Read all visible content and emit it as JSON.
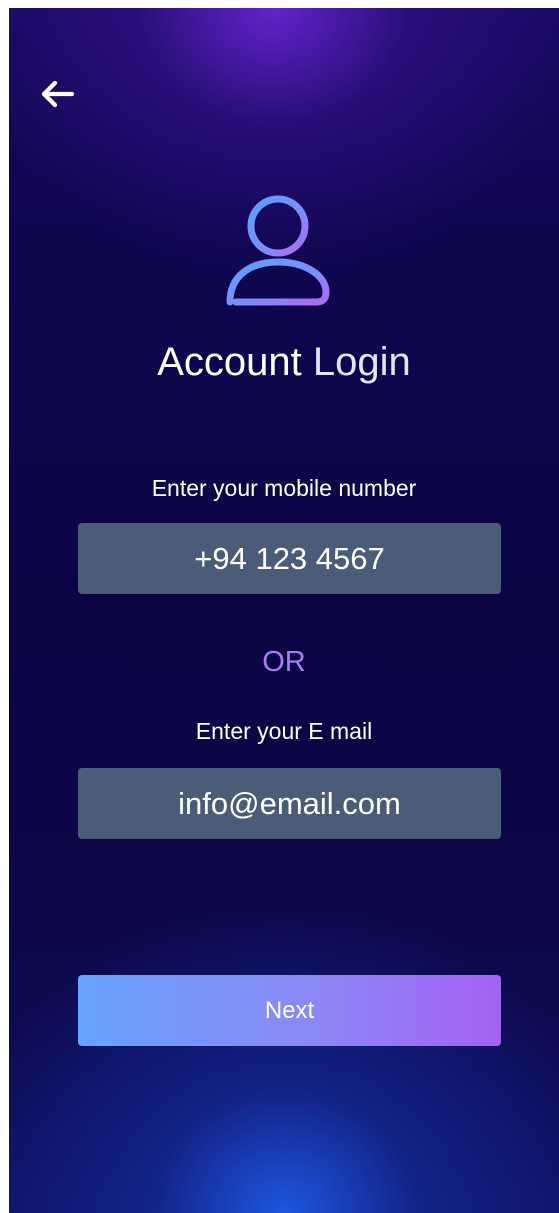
{
  "header": {
    "back_icon": "arrow-left-icon"
  },
  "hero": {
    "icon": "user-icon",
    "title_strong": "Account",
    "title_light": "Login"
  },
  "form": {
    "mobile_label": "Enter your mobile number",
    "mobile_value": "+94 123 4567",
    "separator": "OR",
    "email_label": "Enter your E mail",
    "email_value": "info@email.com",
    "next_label": "Next"
  },
  "colors": {
    "background_top": "#1a0a63",
    "background_mid": "#0b0544",
    "background_glow_bottom": "#1e5ae6",
    "field_bg": "#4a5c78",
    "or_text": "#a97cf2",
    "button_gradient_start": "#66a3ff",
    "button_gradient_end": "#a462f2",
    "icon_gradient_start": "#5aa0ff",
    "icon_gradient_end": "#b06af0"
  }
}
